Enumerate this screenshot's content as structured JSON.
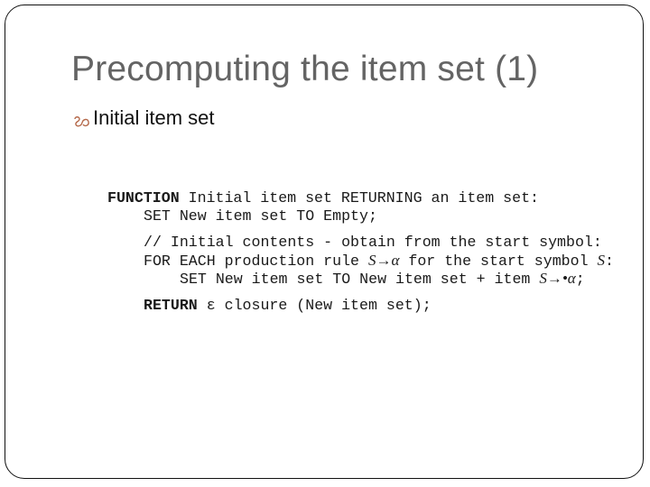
{
  "slide": {
    "title": "Precomputing the item set (1)",
    "bullet": {
      "icon": "decorative-bullet-icon",
      "icon_color": "#b5694a",
      "text": "Initial item set"
    },
    "code": {
      "line1": {
        "kw": "FUNCTION",
        "rest": " Initial item set RETURNING an item set:"
      },
      "line2": {
        "kw": "SET",
        "rest": " New item set TO Empty;"
      },
      "line3": {
        "text": "// Initial contents - obtain from the start symbol:"
      },
      "line4": {
        "kw": "FOR EACH",
        "pre": " production rule ",
        "math": "S→α",
        "post": " for the start symbol ",
        "math2": "S",
        "end": ":"
      },
      "line5": {
        "kw": "SET",
        "pre": " New item set TO New item set + item ",
        "math": "S→•α",
        "end": ";"
      },
      "line6": {
        "kw": "RETURN",
        "pre": " ε closure (New item set);"
      }
    }
  },
  "colors": {
    "title": "#646464",
    "text": "#111111",
    "bullet": "#b5694a",
    "border": "#111111"
  }
}
